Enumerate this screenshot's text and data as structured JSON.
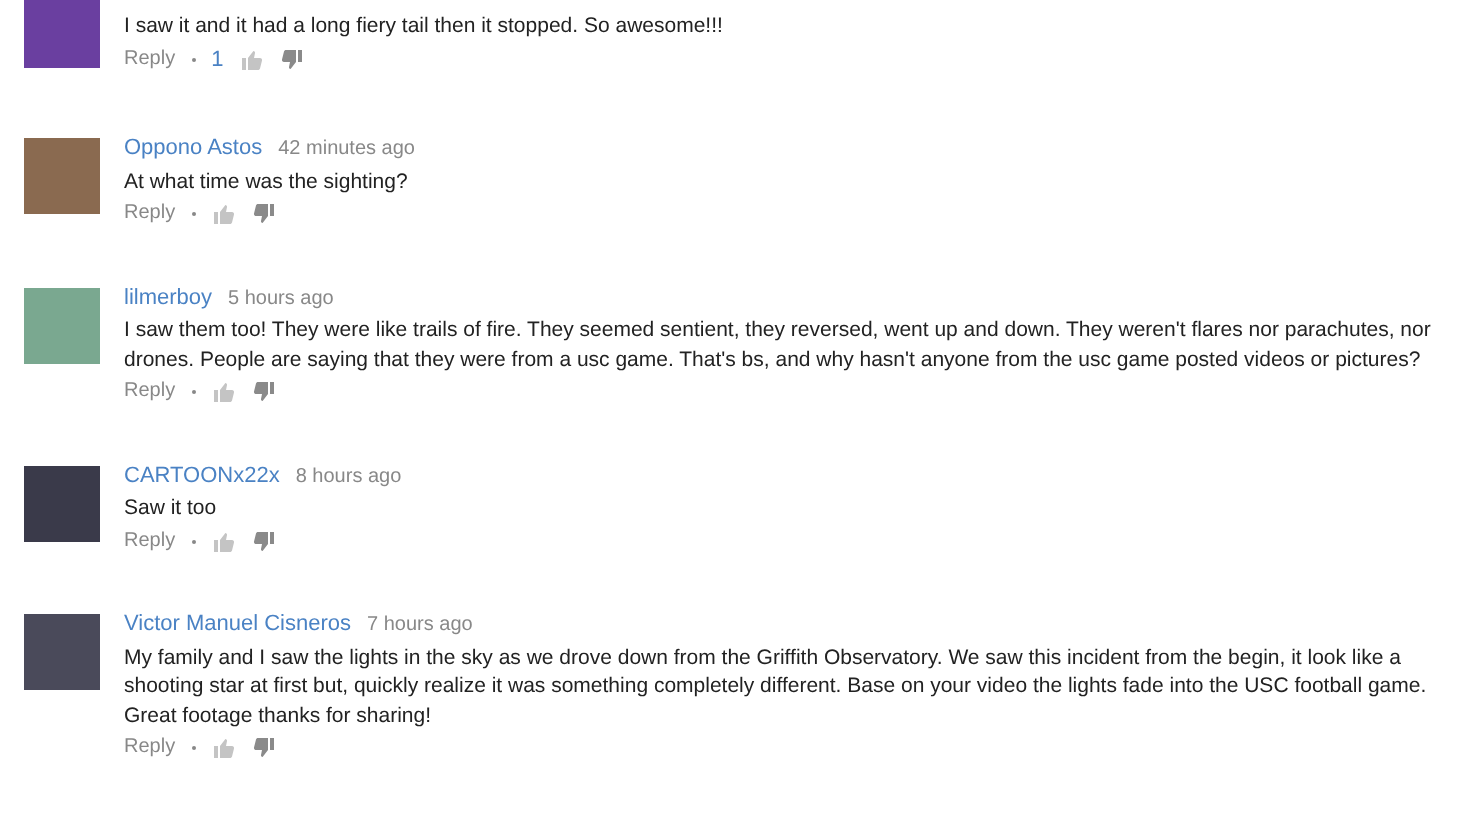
{
  "comments": [
    {
      "text": "I saw it and it had a long fiery tail then it stopped. So awesome!!!",
      "reply": "Reply",
      "likes": "1"
    },
    {
      "author": "Oppono Astos",
      "time": "42 minutes ago",
      "text": "At what time was the sighting?",
      "reply": "Reply"
    },
    {
      "author": "lilmerboy",
      "time": "5 hours ago",
      "text": "I saw them too! They were like trails of fire. They seemed sentient, they reversed, went up and down. They weren't flares nor parachutes, nor drones. People are saying that they were from a usc game. That's bs, and why hasn't anyone from the usc game posted videos or pictures?",
      "reply": "Reply"
    },
    {
      "author": "CARTOONx22x",
      "time": "8 hours ago",
      "text": "Saw it too",
      "reply": "Reply"
    },
    {
      "author": "Victor Manuel Cisneros",
      "time": "7 hours ago",
      "text": "My family and I saw the lights in the sky as we drove down from the Griffith Observatory. We saw this incident from the begin, it look like a shooting star at first but, quickly realize it was something completely different. Base on your video the lights fade into the USC football game. Great footage thanks for sharing!",
      "reply": "Reply"
    }
  ]
}
